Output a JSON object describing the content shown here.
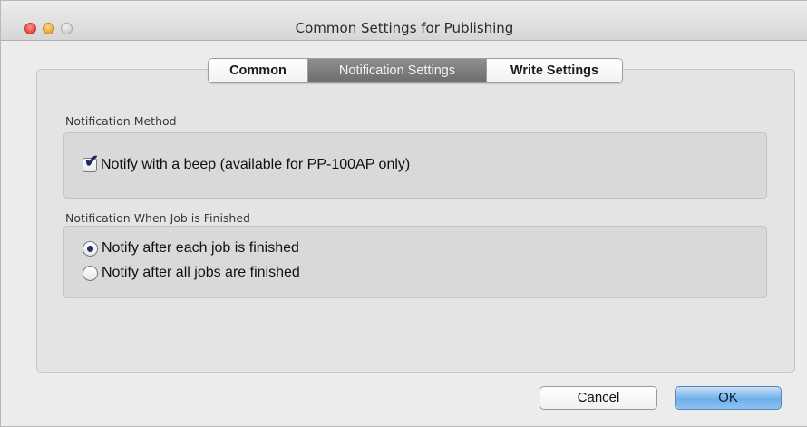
{
  "window": {
    "title": "Common Settings for Publishing"
  },
  "tabs": [
    {
      "label": "Common",
      "selected": false
    },
    {
      "label": "Notification Settings",
      "selected": true
    },
    {
      "label": "Write Settings",
      "selected": false
    }
  ],
  "notification_method": {
    "label": "Notification Method",
    "beep_checkbox": {
      "label": "Notify with a beep (available for PP-100AP only)",
      "checked": true
    }
  },
  "job_finished": {
    "label": "Notification When Job is Finished",
    "options": [
      {
        "label": "Notify after each job is finished",
        "selected": true
      },
      {
        "label": "Notify after all jobs are finished",
        "selected": false
      }
    ]
  },
  "buttons": {
    "cancel": "Cancel",
    "ok": "OK"
  },
  "colors": {
    "selected_tab": "#7d7d7d",
    "ok_button": "#6fb0ea",
    "close_button": "#e2463f",
    "minimize_button": "#e3a32f"
  }
}
